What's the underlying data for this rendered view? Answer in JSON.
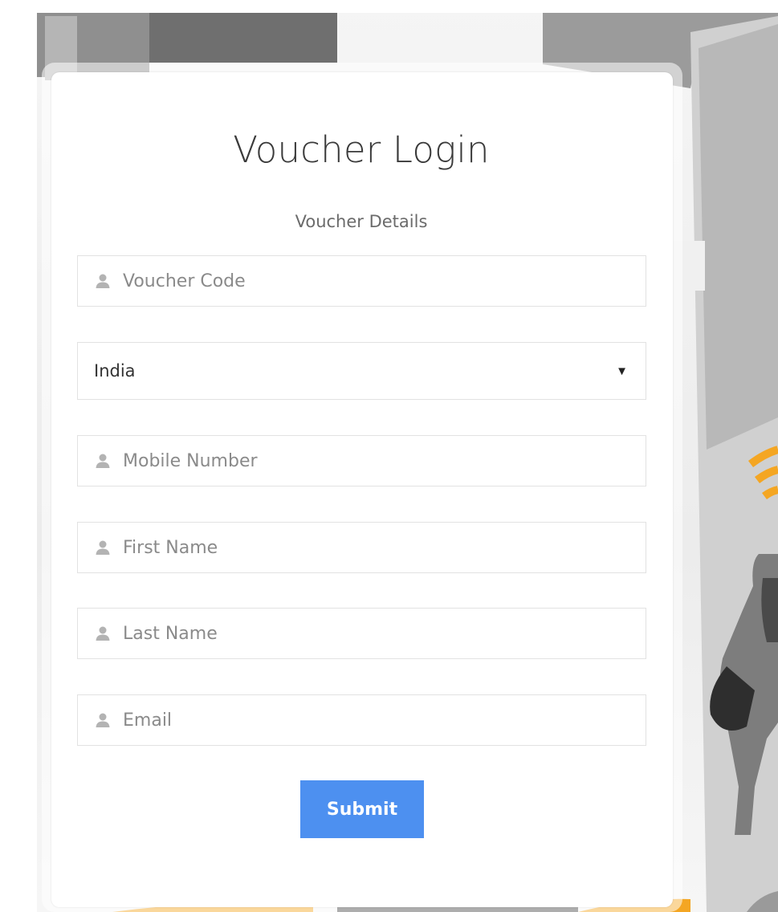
{
  "form": {
    "title": "Voucher Login",
    "subtitle": "Voucher Details",
    "voucher_code": {
      "value": "",
      "placeholder": "Voucher Code",
      "icon": "user-icon"
    },
    "country": {
      "selected": "India",
      "icon": "dropdown-caret-icon"
    },
    "mobile_number": {
      "value": "",
      "placeholder": "Mobile Number",
      "icon": "user-icon"
    },
    "first_name": {
      "value": "",
      "placeholder": "First Name",
      "icon": "user-icon"
    },
    "last_name": {
      "value": "",
      "placeholder": "Last Name",
      "icon": "user-icon"
    },
    "email": {
      "value": "",
      "placeholder": "Email",
      "icon": "user-icon"
    },
    "submit_label": "Submit"
  },
  "colors": {
    "accent": "#4d90f0",
    "title_text": "#3a3a3a",
    "placeholder_text": "#8a8a8a",
    "field_border": "#e2e2e2",
    "wifi_orange": "#f4a623"
  }
}
